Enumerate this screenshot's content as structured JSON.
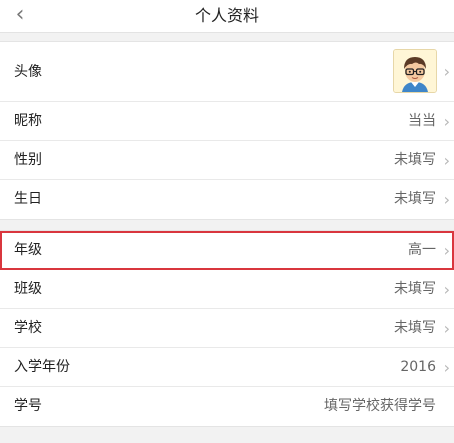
{
  "nav": {
    "title": "个人资料",
    "back_icon": "chevron-left-icon"
  },
  "group1": {
    "rows": [
      {
        "label": "头像",
        "value": ""
      },
      {
        "label": "昵称",
        "value": "当当"
      },
      {
        "label": "性别",
        "value": "未填写"
      },
      {
        "label": "生日",
        "value": "未填写"
      }
    ]
  },
  "group2": {
    "rows": [
      {
        "label": "年级",
        "value": "高一"
      },
      {
        "label": "班级",
        "value": "未填写"
      },
      {
        "label": "学校",
        "value": "未填写"
      },
      {
        "label": "入学年份",
        "value": "2016"
      },
      {
        "label": "学号",
        "value": "填写学校获得学号"
      }
    ]
  },
  "colors": {
    "highlight": "#d9363e",
    "background": "#f2f2f2",
    "card": "#ffffff"
  }
}
